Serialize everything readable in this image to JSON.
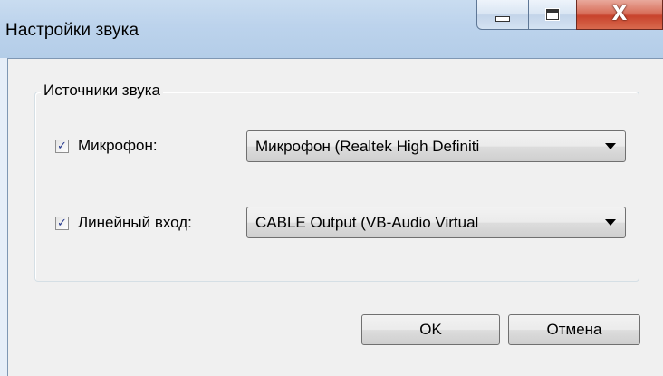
{
  "window": {
    "title": "Настройки звука"
  },
  "titlebar": {
    "minimize_icon": "minimize-icon",
    "maximize_icon": "maximize-icon",
    "close_icon": "close-icon",
    "close_glyph": "X"
  },
  "group": {
    "label": "Источники звука",
    "microphone": {
      "checked": true,
      "label": "Микрофон:",
      "selected": "Микрофон (Realtek High Definiti"
    },
    "line_in": {
      "checked": true,
      "label": "Линейный вход:",
      "selected": "CABLE Output (VB-Audio Virtual"
    }
  },
  "buttons": {
    "ok": "OK",
    "cancel": "Отмена"
  },
  "colors": {
    "titlebar": "#bcd3ec",
    "client_bg": "#f0f0f0",
    "close_button": "#c8432c",
    "check_mark": "#2a3c8f"
  }
}
